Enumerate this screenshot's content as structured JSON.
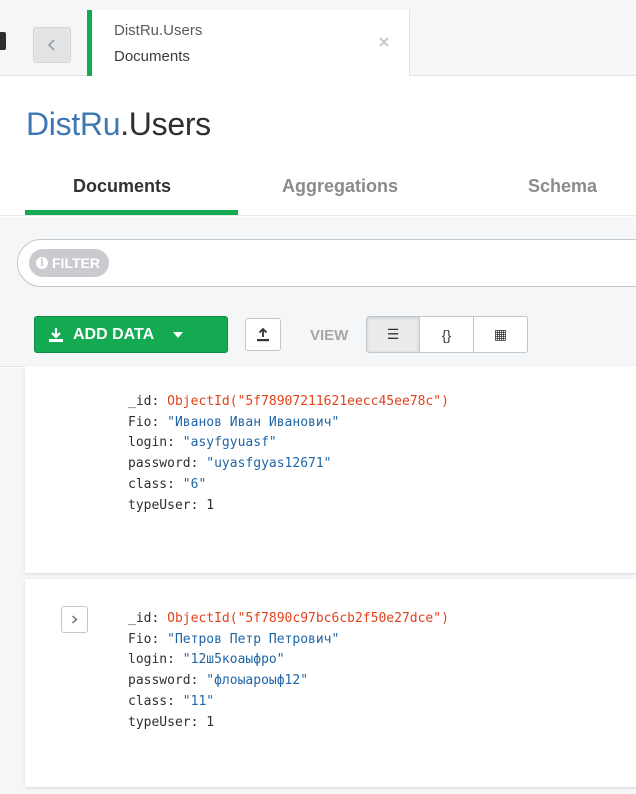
{
  "tab": {
    "namespace": "DistRu.Users",
    "type": "Documents"
  },
  "header": {
    "db": "DistRu",
    "collection": ".Users"
  },
  "subtabs": [
    "Documents",
    "Aggregations",
    "Schema"
  ],
  "filter": {
    "label": "FILTER"
  },
  "toolbar": {
    "add_data_label": "ADD DATA",
    "view_label": "VIEW",
    "list_icon": "☰",
    "json_icon": "{}",
    "table_icon": "▦"
  },
  "documents": [
    {
      "fields": [
        {
          "key": "_id",
          "value": "ObjectId(\"5f78907211621eecc45ee78c\")"
        },
        {
          "key": "Fio",
          "value": "\"Иванов Иван Иванович\""
        },
        {
          "key": "login",
          "value": "\"asyfgyuasf\""
        },
        {
          "key": "password",
          "value": "\"uyasfgyas12671\""
        },
        {
          "key": "class",
          "value": "\"6\""
        },
        {
          "key": "typeUser",
          "value": "1"
        }
      ]
    },
    {
      "fields": [
        {
          "key": "_id",
          "value": "ObjectId(\"5f7890c97bc6cb2f50e27dce\")"
        },
        {
          "key": "Fio",
          "value": "\"Петров Петр Петрович\""
        },
        {
          "key": "login",
          "value": "\"12ш5коаыфро\""
        },
        {
          "key": "password",
          "value": "\"флоыароыф12\""
        },
        {
          "key": "class",
          "value": "\"11\""
        },
        {
          "key": "typeUser",
          "value": "1"
        }
      ]
    }
  ],
  "colors": {
    "accent": "#13aa52",
    "db_blue": "#3d78b5",
    "string": "#1f65a6",
    "objectid": "#e2421a"
  },
  "icons": {
    "back": "chevron-left-icon",
    "close": "close-icon",
    "info": "info-icon",
    "download": "download-icon",
    "export": "export-icon",
    "expand": "chevron-right-icon"
  }
}
